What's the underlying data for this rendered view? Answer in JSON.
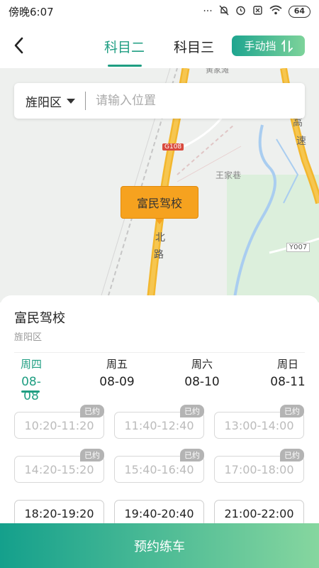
{
  "status_bar": {
    "time": "傍晚6:07",
    "battery": "64"
  },
  "header": {
    "tabs": [
      {
        "label": "科目二",
        "active": true
      },
      {
        "label": "科目三",
        "active": false
      }
    ],
    "gear_button": {
      "label": "手动挡",
      "icon": "swap-vertical-icon"
    }
  },
  "map": {
    "labels": {
      "village": "王家巷",
      "road_north": "北",
      "road_lu": "路",
      "expressway_1": "高",
      "expressway_2": "速",
      "top_cut": "黄家滩",
      "g108": "G108",
      "y007": "Y007"
    },
    "marker_label": "富民驾校",
    "marker_color": "#f6a21f"
  },
  "search": {
    "district": "旌阳区",
    "placeholder": "请输入位置"
  },
  "school": {
    "name": "富民驾校",
    "area": "旌阳区"
  },
  "days": [
    {
      "weekday": "周四",
      "date": "08-08",
      "active": true
    },
    {
      "weekday": "周五",
      "date": "08-09",
      "active": false
    },
    {
      "weekday": "周六",
      "date": "08-10",
      "active": false
    },
    {
      "weekday": "周日",
      "date": "08-11",
      "active": false
    }
  ],
  "slots": [
    {
      "time": "10:20-11:20",
      "badge": "已约"
    },
    {
      "time": "11:40-12:40",
      "badge": "已约"
    },
    {
      "time": "13:00-14:00",
      "badge": "已约"
    },
    {
      "time": "14:20-15:20",
      "badge": "已约"
    },
    {
      "time": "15:40-16:40",
      "badge": "已约"
    },
    {
      "time": "17:00-18:00",
      "badge": "已约"
    },
    {
      "time": "18:20-19:20",
      "badge": ""
    },
    {
      "time": "19:40-20:40",
      "badge": ""
    },
    {
      "time": "21:00-22:00",
      "badge": ""
    }
  ],
  "cta": {
    "label": "预约练车"
  },
  "colors": {
    "accent": "#1f9e82",
    "cta_start": "#14a08c",
    "cta_end": "#86d69f"
  }
}
